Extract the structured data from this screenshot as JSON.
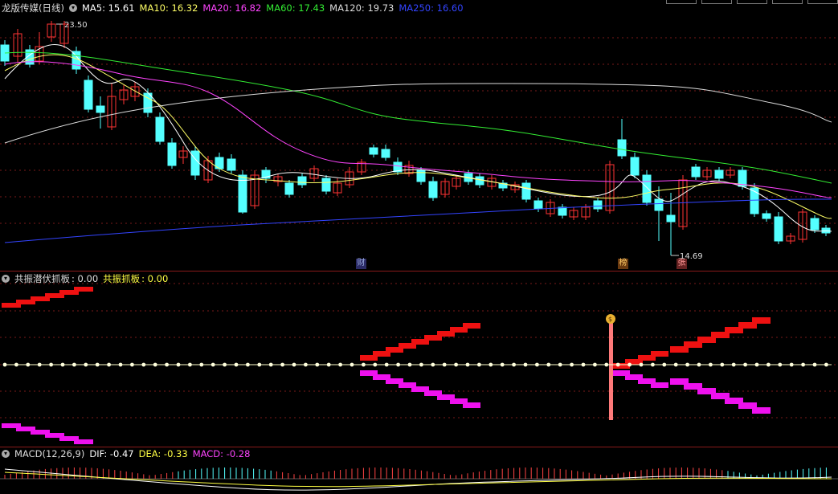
{
  "main": {
    "title": "龙版传媒(日线)",
    "legend": [
      {
        "label": "MA5: 15.61",
        "color": "#ffffff"
      },
      {
        "label": "MA10: 16.32",
        "color": "#ffff66"
      },
      {
        "label": "MA20: 16.82",
        "color": "#ff44ff"
      },
      {
        "label": "MA60: 17.43",
        "color": "#33ee33"
      },
      {
        "label": "MA120: 19.73",
        "color": "#dddddd"
      },
      {
        "label": "MA250: 16.60",
        "color": "#3344ff"
      }
    ],
    "high_label": "23.50",
    "low_label": "14.69",
    "markers": {
      "cai": "财",
      "bang": "榜",
      "zhang": "张"
    }
  },
  "signal": {
    "name": "共振潜伏抓板",
    "value": ": 0.00",
    "name2": "共振抓板",
    "value2": ": 0.00"
  },
  "macd": {
    "name": "MACD(12,26,9)",
    "dif": "DIF: -0.47",
    "dea": "DEA: -0.33",
    "macd": "MACD: -0.28"
  },
  "colors": {
    "up": "#ff3333",
    "down": "#54ffff",
    "grid": "#8a1a1a"
  },
  "icons": {
    "collapse": "circle-chevron-icon",
    "money": "money-bag-icon"
  }
}
